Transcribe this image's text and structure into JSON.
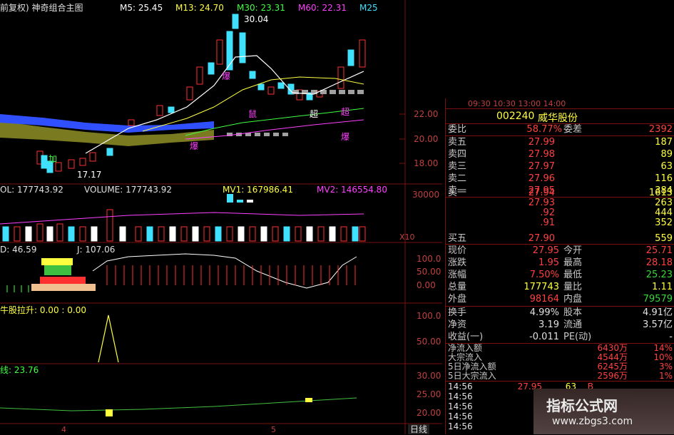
{
  "colors": {
    "up": "#ff3030",
    "down": "#40e0ff",
    "ma5": "#ffffff",
    "ma13": "#ffff40",
    "ma30": "#40ff40",
    "ma60": "#ff40ff",
    "grid": "#7a1010"
  },
  "top_legend": {
    "title": "前复权) 神奇组合主图",
    "m5": "M5: 25.45",
    "m13": "M13: 24.70",
    "m30": "M30: 23.31",
    "m60": "M60: 22.31",
    "m25": "M25"
  },
  "price_annotations": {
    "high": "30.04",
    "low": "17.17",
    "bao1": "爆",
    "bao2": "爆",
    "bao3": "爆",
    "shu": "鼠",
    "chao1": "超",
    "chao2": "超",
    "jia": "加"
  },
  "price_axis": [
    "22.00",
    "20.00",
    "18.00"
  ],
  "volume_legend": {
    "vol": "OL: 177743.92",
    "volume": "VOLUME: 177743.92",
    "mv1": "MV1: 167986.41",
    "mv2": "MV2: 146554.80"
  },
  "volume_axis": {
    "top": "30000",
    "unit": "X10"
  },
  "kdj_legend": {
    "d": "D: 46.59",
    "j": "J: 107.06"
  },
  "kdj_axis": [
    "100.0",
    "50.00",
    "0.00"
  ],
  "niu_legend": {
    "label": "牛股拉升: 0.00 : 0.00"
  },
  "niu_axis": [
    "100.0",
    "50.00"
  ],
  "line_legend": {
    "label": "线: 23.76"
  },
  "line_axis": [
    "30.00",
    "25.00",
    "20.00"
  ],
  "date_axis": [
    "4",
    "5"
  ],
  "period": "日线",
  "time_header": "09:30 10:30 13:00 14:00",
  "stock": {
    "code": "002240",
    "name": "威华股份"
  },
  "quote": {
    "wei_bi_label": "委比",
    "wei_bi": "58.77%",
    "wei_cha_label": "委差",
    "wei_cha": "2392",
    "sells": [
      {
        "label": "卖五",
        "price": "27.99",
        "vol": "187"
      },
      {
        "label": "卖四",
        "price": "27.98",
        "vol": "89"
      },
      {
        "label": "卖三",
        "price": "27.97",
        "vol": "63"
      },
      {
        "label": "卖二",
        "price": "27.96",
        "vol": "116"
      },
      {
        "label": "卖一",
        "price": "27.95",
        "vol": "384"
      }
    ],
    "buys": [
      {
        "label": "买一",
        "price": "27.94",
        "vol": "1613"
      },
      {
        "label": "",
        "price": "27.93",
        "vol": "263"
      },
      {
        "label": "",
        "price": ".92",
        "vol": "444"
      },
      {
        "label": "",
        "price": ".91",
        "vol": "352"
      },
      {
        "label": "买五",
        "price": "27.90",
        "vol": "559"
      }
    ],
    "stats": [
      {
        "l1": "现价",
        "v1": "27.95",
        "l2": "今开",
        "v2": "25.71"
      },
      {
        "l1": "涨跌",
        "v1": "1.95",
        "l2": "最高",
        "v2": "28.18"
      },
      {
        "l1": "涨幅",
        "v1": "7.50%",
        "l2": "最低",
        "v2": "25.23"
      },
      {
        "l1": "总量",
        "v1": "177743",
        "l2": "量比",
        "v2": "1.11"
      },
      {
        "l1": "外盘",
        "v1": "98164",
        "l2": "内盘",
        "v2": "79579"
      }
    ],
    "stats2": [
      {
        "l1": "换手",
        "v1": "4.99%",
        "l2": "股本",
        "v2": "4.91亿"
      },
      {
        "l1": "净资",
        "v1": "3.19",
        "l2": "流通",
        "v2": "3.57亿"
      },
      {
        "l1": "收益(一)",
        "v1": "-0.011",
        "l2": "PE(动)",
        "v2": "-"
      }
    ],
    "flows": [
      {
        "label": "净流入额",
        "val": "6430万",
        "pct": "14%"
      },
      {
        "label": "大宗流入",
        "val": "4544万",
        "pct": "10%"
      },
      {
        "label": "5日净流入额",
        "val": "6245万",
        "pct": "3%"
      },
      {
        "label": "5日大宗流入",
        "val": "2596万",
        "pct": "1%"
      }
    ],
    "ticks": [
      {
        "time": "14:56",
        "price": "27.95",
        "vol": "63",
        "bs": "B"
      },
      {
        "time": "14:56",
        "price": "",
        "vol": "",
        "bs": ""
      },
      {
        "time": "14:56",
        "price": "",
        "vol": "",
        "bs": ""
      },
      {
        "time": "14:56",
        "price": "",
        "vol": "",
        "bs": ""
      },
      {
        "time": "14:56",
        "price": "",
        "vol": "",
        "bs": ""
      }
    ]
  },
  "watermark": {
    "title": "指标公式网",
    "url": "www.zbgs3.com"
  }
}
